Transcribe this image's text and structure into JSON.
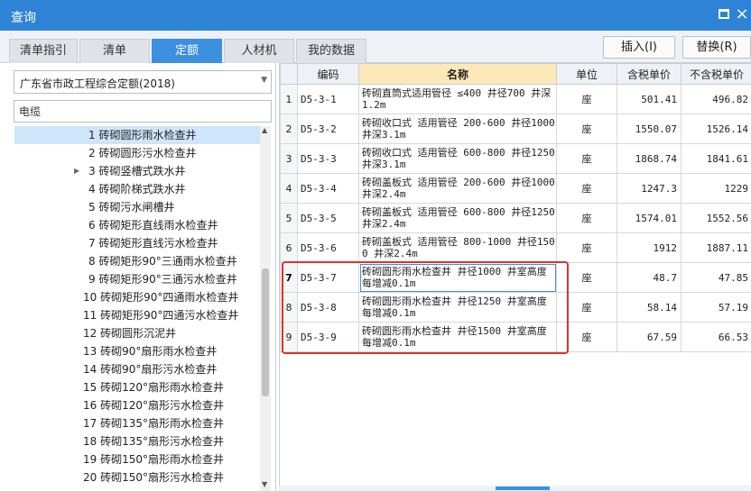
{
  "window": {
    "title": "查询",
    "max_icon": "maximize-icon",
    "close_symbol": "×"
  },
  "tabs": [
    {
      "label": "清单指引"
    },
    {
      "label": "清单"
    },
    {
      "label": "定额",
      "active": true
    },
    {
      "label": "人材机"
    },
    {
      "label": "我的数据"
    }
  ],
  "toolbar": {
    "insert_label": "插入(I)",
    "replace_label": "替换(R)"
  },
  "left": {
    "dropdown_value": "广东省市政工程综合定额(2018)",
    "search_value": "电缆",
    "tree": [
      {
        "label": "1 砖砌圆形雨水检查井",
        "selected": true
      },
      {
        "label": "2 砖砌圆形污水检查井"
      },
      {
        "label": "3 砖砌竖槽式跌水井",
        "expandable": true
      },
      {
        "label": "4 砖砌阶梯式跌水井"
      },
      {
        "label": "5 砖砌污水闸槽井"
      },
      {
        "label": "6 砖砌矩形直线雨水检查井"
      },
      {
        "label": "7 砖砌矩形直线污水检查井"
      },
      {
        "label": "8 砖砌矩形90°三通雨水检查井"
      },
      {
        "label": "9 砖砌矩形90°三通污水检查井"
      },
      {
        "label": "10 砖砌矩形90°四通雨水检查井"
      },
      {
        "label": "11 砖砌矩形90°四通污水检查井"
      },
      {
        "label": "12 砖砌圆形沉泥井"
      },
      {
        "label": "13 砖砌90°扇形雨水检查井"
      },
      {
        "label": "14 砖砌90°扇形污水检查井"
      },
      {
        "label": "15 砖砌120°扇形雨水检查井"
      },
      {
        "label": "16 砖砌120°扇形污水检查井"
      },
      {
        "label": "17 砖砌135°扇形雨水检查井"
      },
      {
        "label": "18 砖砌135°扇形污水检查井"
      },
      {
        "label": "19 砖砌150°扇形雨水检查井"
      },
      {
        "label": "20 砖砌150°扇形污水检查井"
      }
    ]
  },
  "grid": {
    "headers": [
      "",
      "编码",
      "名称",
      "单位",
      "含税单价",
      "不含税单价"
    ],
    "rows": [
      {
        "idx": "1",
        "code": "D5-3-1",
        "name": "砖砌直筒式适用管径 ≤400 井径700 井深1.2m",
        "unit": "座",
        "tax_price": "501.41",
        "notax_price": "496.82"
      },
      {
        "idx": "2",
        "code": "D5-3-2",
        "name": "砖砌收口式 适用管径 200-600 井径1000 井深3.1m",
        "unit": "座",
        "tax_price": "1550.07",
        "notax_price": "1526.14"
      },
      {
        "idx": "3",
        "code": "D5-3-3",
        "name": "砖砌收口式 适用管径 600-800 井径1250 井深3.1m",
        "unit": "座",
        "tax_price": "1868.74",
        "notax_price": "1841.61"
      },
      {
        "idx": "4",
        "code": "D5-3-4",
        "name": "砖砌盖板式 适用管径 200-600 井径1000 井深2.4m",
        "unit": "座",
        "tax_price": "1247.3",
        "notax_price": "1229"
      },
      {
        "idx": "5",
        "code": "D5-3-5",
        "name": "砖砌盖板式 适用管径 600-800 井径1250 井深2.4m",
        "unit": "座",
        "tax_price": "1574.01",
        "notax_price": "1552.56"
      },
      {
        "idx": "6",
        "code": "D5-3-6",
        "name": "砖砌盖板式 适用管径 800-1000 井径1500 井深2.4m",
        "unit": "座",
        "tax_price": "1912",
        "notax_price": "1887.11"
      },
      {
        "idx": "7",
        "code": "D5-3-7",
        "name": "砖砌圆形雨水检查井 井径1000 井室高度每增减0.1m",
        "unit": "座",
        "tax_price": "48.7",
        "notax_price": "47.85",
        "current": true
      },
      {
        "idx": "8",
        "code": "D5-3-8",
        "name": "砖砌圆形雨水检查井 井径1250 井室高度每增减0.1m",
        "unit": "座",
        "tax_price": "58.14",
        "notax_price": "57.19"
      },
      {
        "idx": "9",
        "code": "D5-3-9",
        "name": "砖砌圆形雨水检查井 井径1500 井室高度每增减0.1m",
        "unit": "座",
        "tax_price": "67.59",
        "notax_price": "66.53"
      }
    ]
  },
  "colors": {
    "titlebar": "#2f83d6",
    "active_tab": "#3d8fe0",
    "highlight_box": "#e0322d",
    "name_header": "#fde9b8"
  }
}
